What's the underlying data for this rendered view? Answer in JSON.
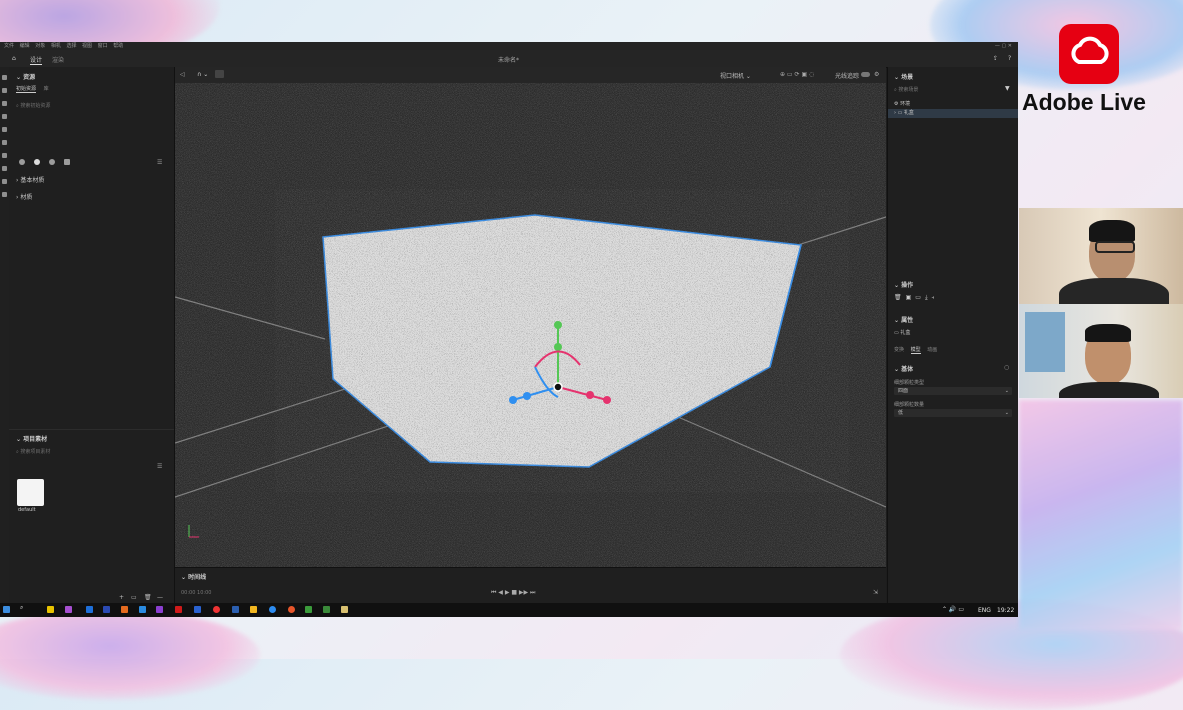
{
  "app": {
    "menu": [
      "文件",
      "编辑",
      "对象",
      "相机",
      "选择",
      "视图",
      "窗口",
      "帮助"
    ],
    "tabs": [
      "设计",
      "渲染"
    ],
    "doc_title": "未命名*",
    "camera_select": "视口相机",
    "camera_toggle_label": "光线追踪"
  },
  "left_panel": {
    "assets_title": "资源",
    "subtabs": [
      "初始资源",
      "库"
    ],
    "search_placeholder": "搜索初始资源",
    "groups": [
      "基本材质",
      "材质"
    ],
    "project_title": "项目素材",
    "project_search_placeholder": "搜索项目素材",
    "material_name": "default"
  },
  "timeline": {
    "title": "时间线",
    "start_time": "00:00",
    "end_time": "10:00"
  },
  "right_panel": {
    "scene_title": "场景",
    "scene_search_placeholder": "搜索场景",
    "scene_items": [
      "环境",
      "礼盒"
    ],
    "actions_title": "操作",
    "properties_title": "属性",
    "selected_name": "礼盒",
    "prop_tabs": [
      "变换",
      "模型",
      "动画"
    ],
    "section_title": "基体",
    "field1_label": "细部颗粒类型",
    "field1_value": "四面",
    "field2_label": "细部颗粒数量",
    "field2_value": "低"
  },
  "taskbar": {
    "language": "ENG",
    "time": "19:22"
  },
  "overlay": {
    "brand_text": "Adobe Live"
  },
  "colors": {
    "app_bg": "#1d1d1d",
    "accent_blue": "#3a8ee6",
    "gizmo_red": "#e5336e",
    "gizmo_green": "#55c755",
    "gizmo_blue": "#2f8ff0"
  }
}
